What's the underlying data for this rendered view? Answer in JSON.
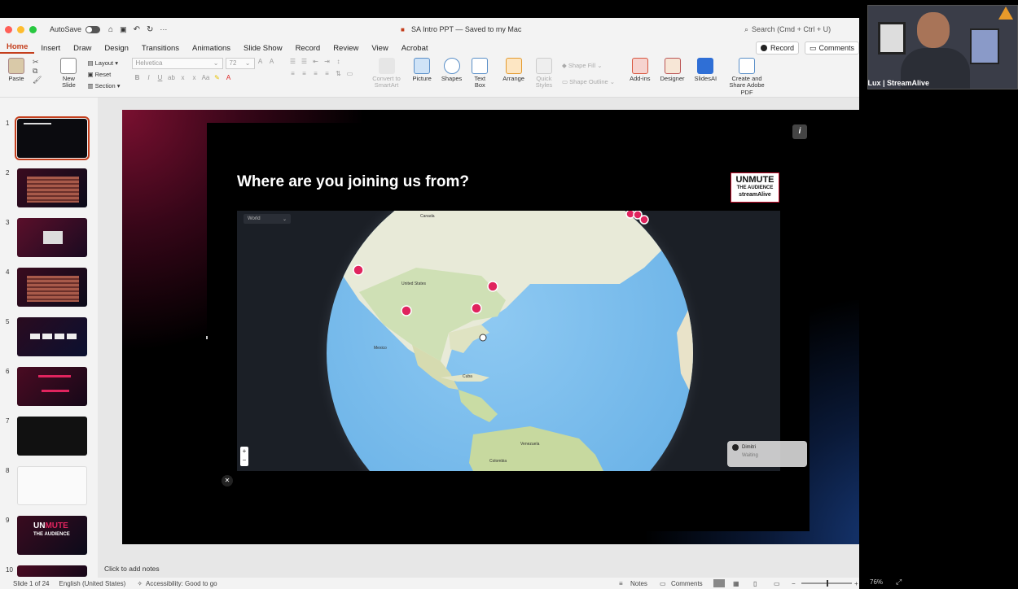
{
  "window": {
    "autosave_label": "AutoSave",
    "doc_title": "SA Intro PPT — Saved to my Mac",
    "search_placeholder": "Search (Cmd + Ctrl + U)"
  },
  "tabs": [
    "Home",
    "Insert",
    "Draw",
    "Design",
    "Transitions",
    "Animations",
    "Slide Show",
    "Record",
    "Review",
    "View",
    "Acrobat"
  ],
  "tab_active": "Home",
  "tab_right": {
    "record": "Record",
    "comments": "Comments"
  },
  "ribbon": {
    "paste": "Paste",
    "new_slide": "New Slide",
    "layout": "Layout",
    "reset": "Reset",
    "section": "Section",
    "font_name": "Helvetica",
    "font_size": "72",
    "convert": "Convert to SmartArt",
    "picture": "Picture",
    "shapes": "Shapes",
    "text_box": "Text Box",
    "arrange": "Arrange",
    "quick_styles": "Quick Styles",
    "shape_fill": "Shape Fill",
    "shape_outline": "Shape Outline",
    "add_ins": "Add-ins",
    "designer": "Designer",
    "slidesai": "SlidesAI",
    "create_share": "Create and Share Adobe PDF"
  },
  "thumbnails": [
    "1",
    "2",
    "3",
    "4",
    "5",
    "6",
    "7",
    "8",
    "9",
    "10"
  ],
  "slide": {
    "title": "Where are you joining us from?",
    "logo_line1": "UNMUTE",
    "logo_line2": "THE AUDIENCE",
    "logo_line3": "streamAlive",
    "info_icon": "i",
    "map_dropdown": "World",
    "map_labels": [
      "Canada",
      "United States",
      "Mexico",
      "Cuba",
      "Venezuela",
      "Colombia"
    ],
    "zoom_in": "+",
    "zoom_out": "−",
    "toast_name": "Dimitri",
    "toast_sub": "Waiting"
  },
  "notes_placeholder": "Click to add notes",
  "status": {
    "slide_pos": "Slide 1 of 24",
    "language": "English (United States)",
    "accessibility": "Accessibility: Good to go",
    "notes": "Notes",
    "comments": "Comments",
    "zoom": "76%"
  },
  "video": {
    "name": "Lux | StreamAlive"
  },
  "colors": {
    "accent": "#c43e1c",
    "pin": "#e0245e"
  }
}
